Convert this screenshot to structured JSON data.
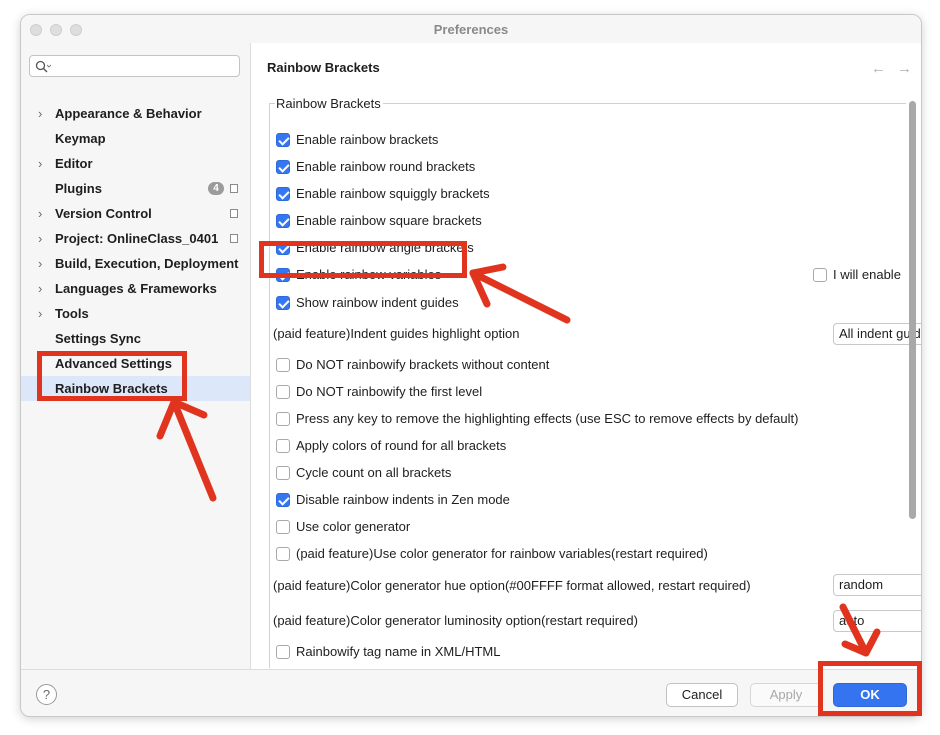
{
  "window": {
    "title": "Preferences"
  },
  "search": {
    "placeholder": ""
  },
  "sidebar": {
    "items": [
      {
        "label": "Appearance & Behavior",
        "expandable": true
      },
      {
        "label": "Keymap",
        "expandable": false
      },
      {
        "label": "Editor",
        "expandable": true
      },
      {
        "label": "Plugins",
        "expandable": false,
        "badge": "4"
      },
      {
        "label": "Version Control",
        "expandable": true
      },
      {
        "label": "Project: OnlineClass_0401",
        "expandable": true
      },
      {
        "label": "Build, Execution, Deployment",
        "expandable": true
      },
      {
        "label": "Languages & Frameworks",
        "expandable": true
      },
      {
        "label": "Tools",
        "expandable": true
      },
      {
        "label": "Settings Sync",
        "expandable": false
      },
      {
        "label": "Advanced Settings",
        "expandable": false
      },
      {
        "label": "Rainbow Brackets",
        "expandable": false,
        "selected": true
      }
    ]
  },
  "main": {
    "title": "Rainbow Brackets",
    "group_title": "Rainbow Brackets",
    "options": [
      {
        "label": "Enable rainbow brackets",
        "checked": true
      },
      {
        "label": "Enable rainbow round brackets",
        "checked": true
      },
      {
        "label": "Enable rainbow squiggly brackets",
        "checked": true
      },
      {
        "label": "Enable rainbow square brackets",
        "checked": true
      },
      {
        "label": "Enable rainbow angle brackets",
        "checked": true
      },
      {
        "label": "Enable rainbow variables",
        "checked": true
      },
      {
        "label": "Show rainbow indent guides",
        "checked": true
      }
    ],
    "side_option": {
      "label": "I will enable",
      "checked": false
    },
    "indent_highlight": {
      "label": "(paid feature)Indent guides highlight option",
      "value": "All indent guid"
    },
    "options2": [
      {
        "label": "Do NOT rainbowify brackets without content",
        "checked": false
      },
      {
        "label": "Do NOT rainbowify the first level",
        "checked": false
      },
      {
        "label": "Press any key to remove the highlighting effects (use ESC to remove effects by default)",
        "checked": false
      },
      {
        "label": "Apply colors of round for all brackets",
        "checked": false
      },
      {
        "label": "Cycle count on all brackets",
        "checked": false
      },
      {
        "label": "Disable rainbow indents in Zen mode",
        "checked": true
      },
      {
        "label": "Use color generator",
        "checked": false
      },
      {
        "label": "(paid feature)Use color generator for rainbow variables(restart required)",
        "checked": false
      }
    ],
    "hue_option": {
      "label": "(paid feature)Color generator hue option(#00FFFF format allowed, restart required)",
      "value": "random"
    },
    "luminosity_option": {
      "label": "(paid feature)Color generator luminosity option(restart required)",
      "value": "auto"
    },
    "xml_option": {
      "label": "Rainbowify tag name in XML/HTML",
      "checked": false
    }
  },
  "footer": {
    "help_label": "?",
    "cancel_label": "Cancel",
    "apply_label": "Apply",
    "ok_label": "OK"
  },
  "colors": {
    "accent": "#3574f0",
    "annotation": "#e1341e",
    "selection": "#dce7fa"
  }
}
